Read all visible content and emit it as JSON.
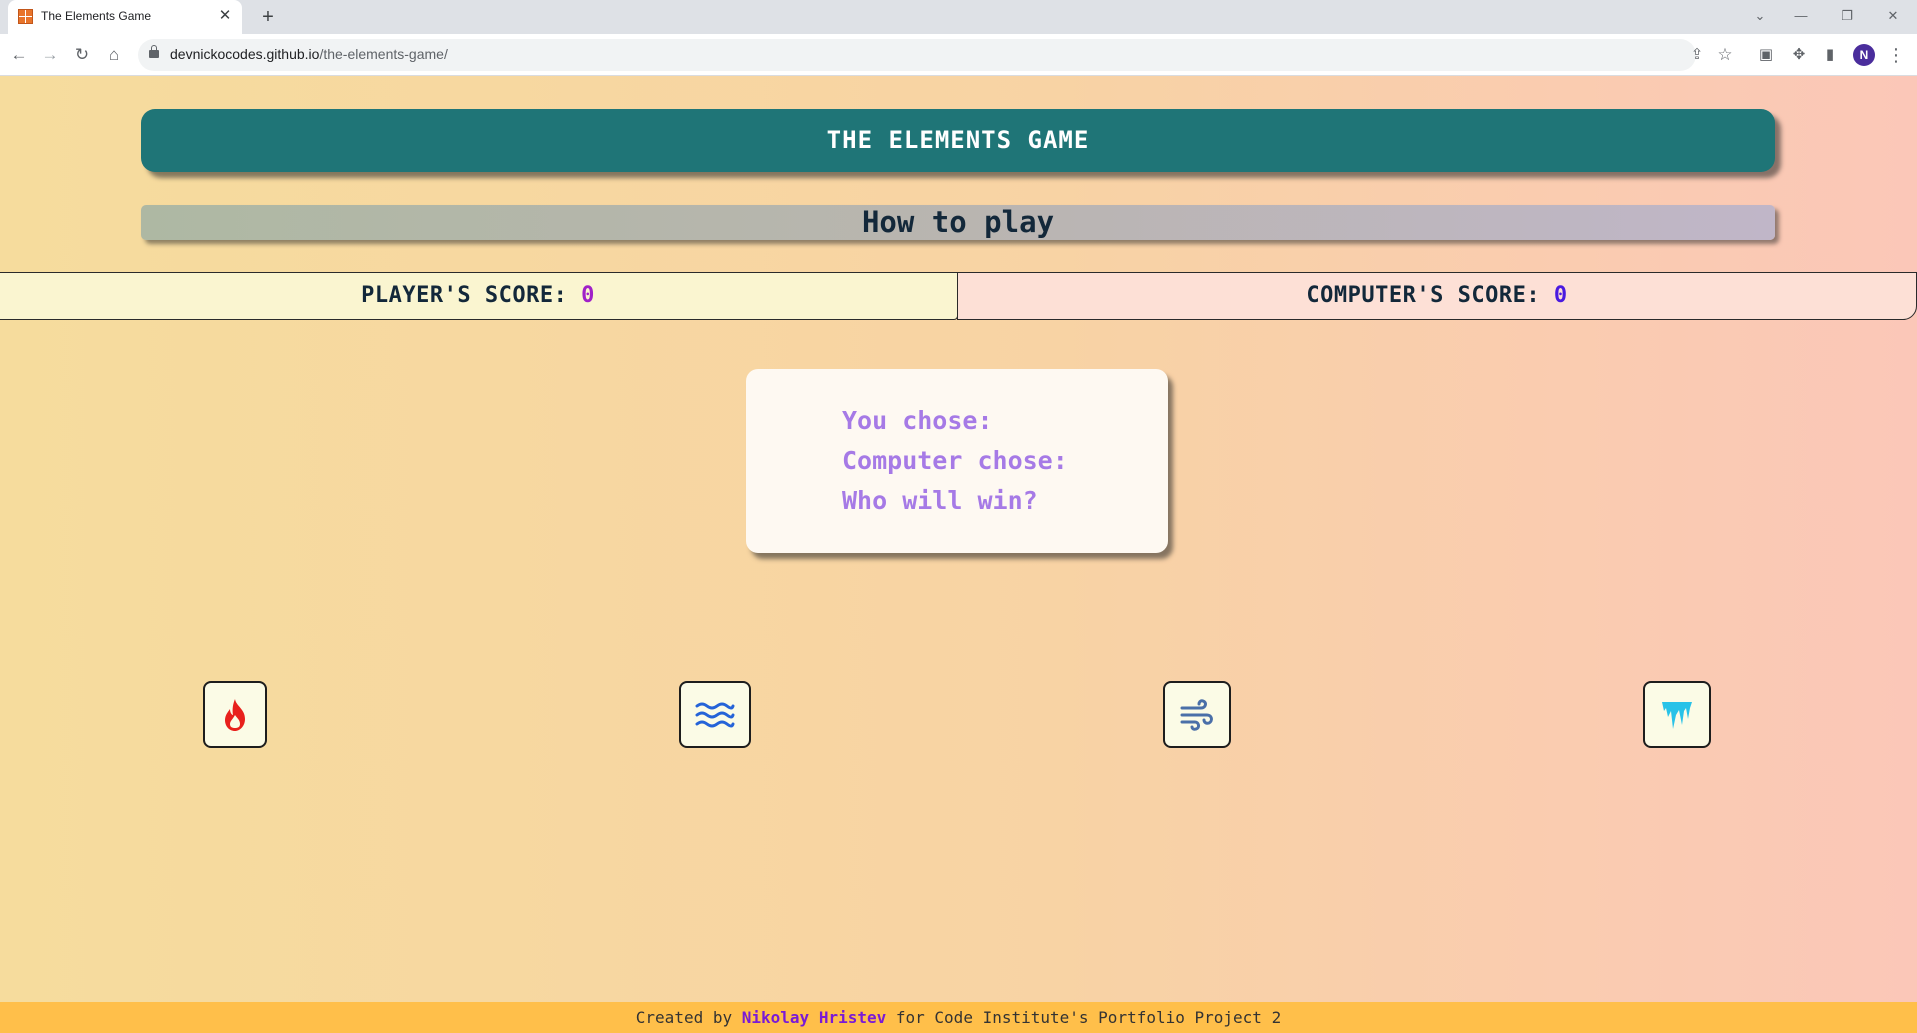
{
  "browser": {
    "tab_title": "The Elements Game",
    "tab_close": "✕",
    "new_tab": "+",
    "url_host": "devnickocodes.github.io",
    "url_path": "/the-elements-game/",
    "profile_initial": "N"
  },
  "game": {
    "title": "THE ELEMENTS GAME",
    "how_to_play": "How to play",
    "player_score_label": "PLAYER'S SCORE: ",
    "player_score": "0",
    "computer_score_label": "COMPUTER'S SCORE: ",
    "computer_score": "0",
    "you_chose": "You chose:",
    "computer_chose": "Computer chose:",
    "who_wins": "Who will win?"
  },
  "choices": [
    {
      "name": "fire",
      "icon": "fire-icon",
      "color": "#e8201c"
    },
    {
      "name": "water",
      "icon": "water-waves-icon",
      "color": "#2563d8"
    },
    {
      "name": "air",
      "icon": "wind-icon",
      "color": "#4a6fa8"
    },
    {
      "name": "ice",
      "icon": "icicles-icon",
      "color": "#28c2e8"
    }
  ],
  "footer": {
    "prefix": "Created by ",
    "author": "Nikolay Hristev",
    "suffix": " for Code Institute's Portfolio Project 2"
  },
  "colors": {
    "header": "#1f7577",
    "score_value": "#a020c8",
    "result_text": "#a67ae6",
    "footer_bg": "#ffbf4a"
  }
}
